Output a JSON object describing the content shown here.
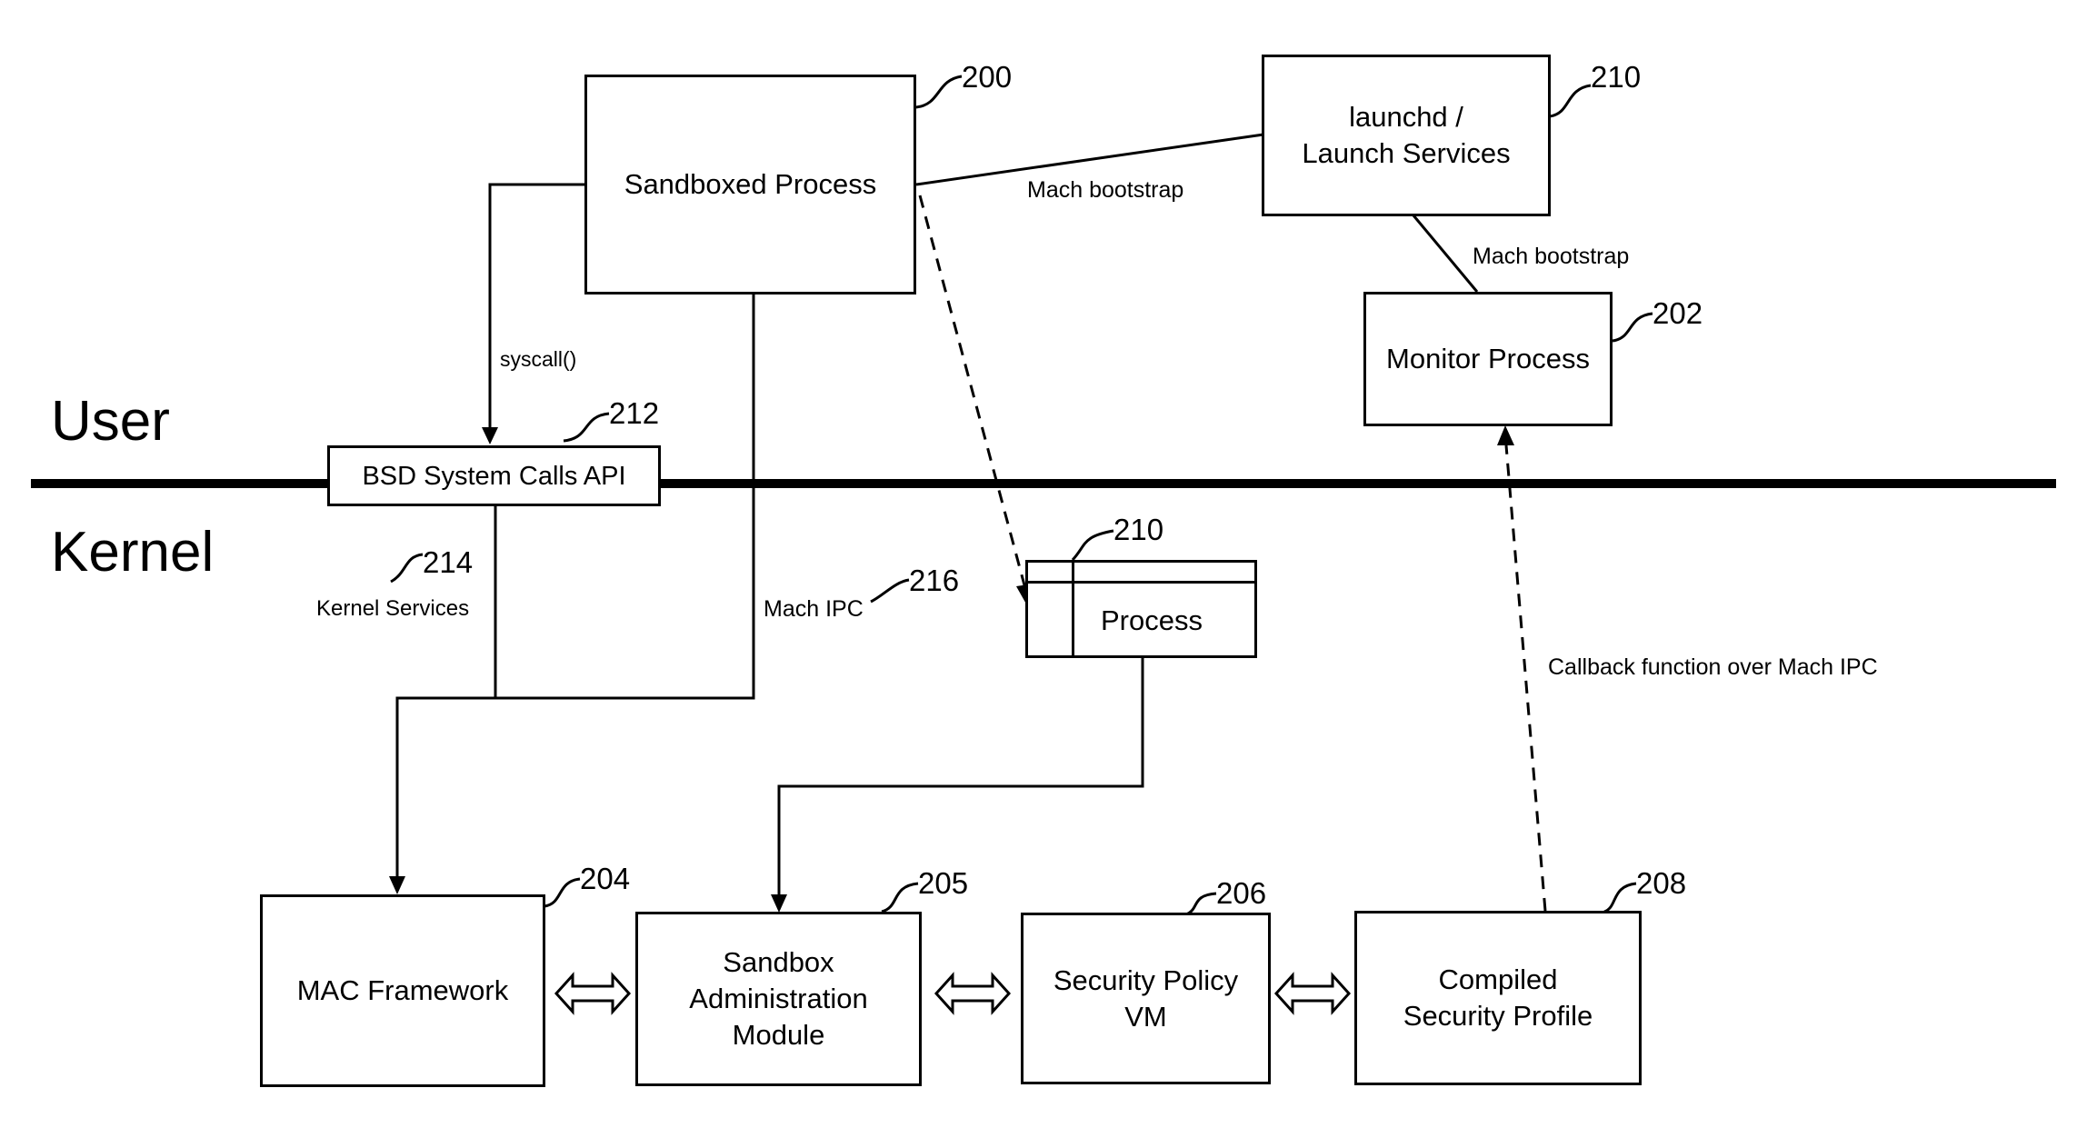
{
  "zones": {
    "user": "User",
    "kernel": "Kernel"
  },
  "boxes": {
    "sandboxed_process": {
      "label": "Sandboxed Process",
      "ref": "200"
    },
    "launchd": {
      "label": "launchd /\nLaunch Services",
      "ref": "210"
    },
    "monitor_process": {
      "label": "Monitor Process",
      "ref": "202"
    },
    "bsd_syscalls": {
      "label": "BSD System Calls API",
      "ref": "212"
    },
    "process": {
      "label": "Process",
      "ref": "210"
    },
    "mac_framework": {
      "label": "MAC Framework",
      "ref": "204"
    },
    "sandbox_admin": {
      "label": "Sandbox\nAdministration\nModule",
      "ref": "205"
    },
    "security_policy_vm": {
      "label": "Security Policy\nVM",
      "ref": "206"
    },
    "compiled_profile": {
      "label": "Compiled\nSecurity Profile",
      "ref": "208"
    }
  },
  "connectors": {
    "mach_bootstrap_1": "Mach bootstrap",
    "mach_bootstrap_2": "Mach bootstrap",
    "syscall": "syscall()",
    "kernel_services": "Kernel Services",
    "kernel_services_ref": "214",
    "mach_ipc": "Mach IPC",
    "mach_ipc_ref": "216",
    "callback": "Callback function over Mach IPC"
  }
}
